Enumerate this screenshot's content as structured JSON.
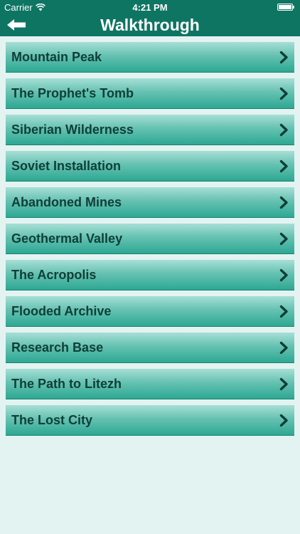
{
  "status_bar": {
    "carrier": "Carrier",
    "time": "4:21 PM"
  },
  "nav": {
    "title": "Walkthrough",
    "back_icon": "back-arrow-icon"
  },
  "colors": {
    "header": "#0e7563",
    "background": "#e3f3f1",
    "item_text": "#0f3e37"
  },
  "items": [
    {
      "label": "Mountain Peak"
    },
    {
      "label": "The Prophet's Tomb"
    },
    {
      "label": "Siberian Wilderness"
    },
    {
      "label": "Soviet Installation"
    },
    {
      "label": "Abandoned Mines"
    },
    {
      "label": "Geothermal Valley"
    },
    {
      "label": "The Acropolis"
    },
    {
      "label": "Flooded Archive"
    },
    {
      "label": "Research Base"
    },
    {
      "label": "The Path to Litezh"
    },
    {
      "label": "The Lost City"
    }
  ]
}
